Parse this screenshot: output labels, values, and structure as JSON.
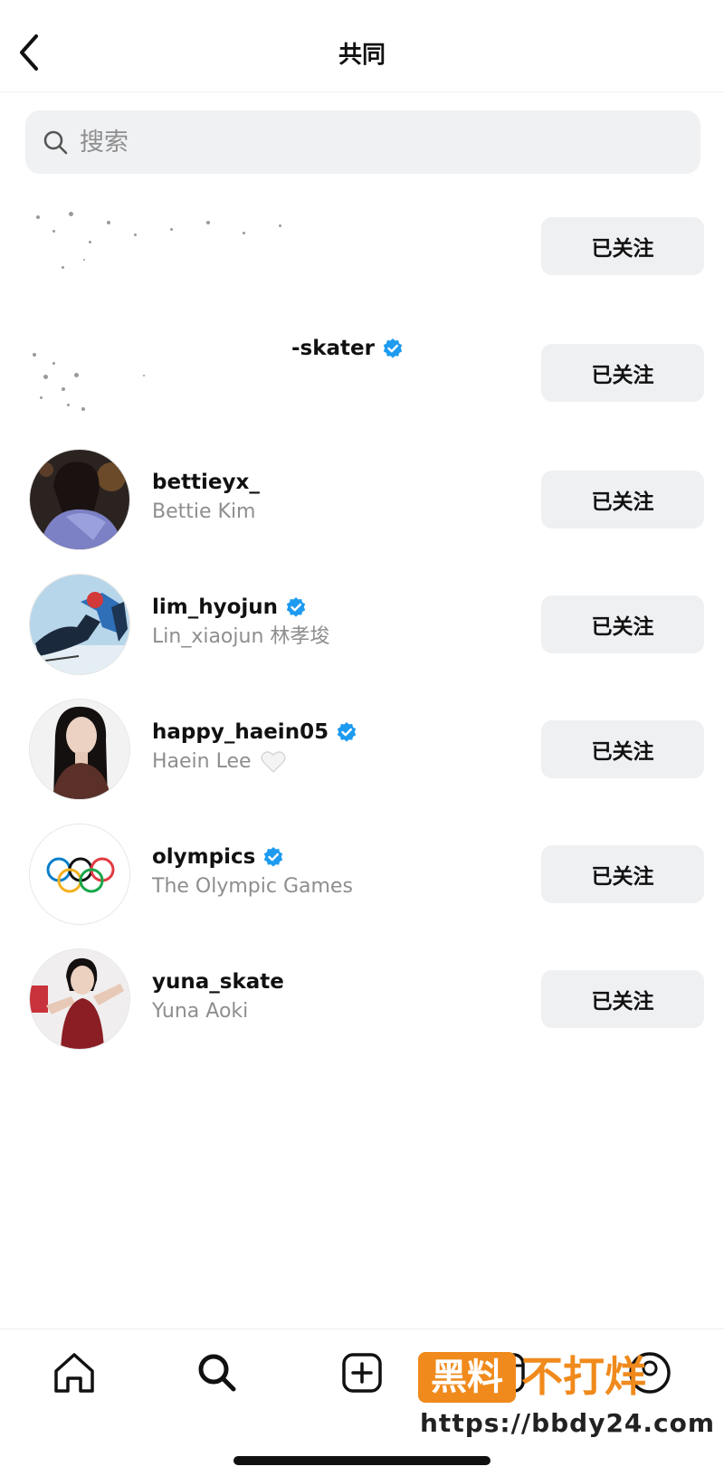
{
  "header": {
    "title": "共同"
  },
  "search": {
    "placeholder": "搜索"
  },
  "users": [
    {
      "username": "",
      "fullname": "",
      "follow_label": "已关注",
      "verified": false,
      "redacted": true
    },
    {
      "username": "-skater",
      "fullname": "",
      "follow_label": "已关注",
      "verified": true,
      "redacted": true
    },
    {
      "username": "bettieyx_",
      "fullname": "Bettie Kim",
      "follow_label": "已关注",
      "verified": false
    },
    {
      "username": "lim_hyojun",
      "fullname": "Lin_xiaojun 林孝埈",
      "follow_label": "已关注",
      "verified": true
    },
    {
      "username": "happy_haein05",
      "fullname": "Haein Lee",
      "follow_label": "已关注",
      "verified": true,
      "fullname_suffix_icon": "white-heart-icon"
    },
    {
      "username": "olympics",
      "fullname": "The Olympic Games",
      "follow_label": "已关注",
      "verified": true
    },
    {
      "username": "yuna_skate",
      "fullname": "Yuna Aoki",
      "follow_label": "已关注",
      "verified": false
    }
  ],
  "bottom_nav": [
    "home-icon",
    "search-icon",
    "create-icon",
    "reels-icon",
    "profile-icon"
  ],
  "watermark": {
    "badge": "黑料",
    "text": "不打烊",
    "url": "https://bbdy24.com"
  },
  "colors": {
    "verified": "#1d9bf0",
    "button_bg": "#eff0f2",
    "secondary_text": "#8e8e8e",
    "watermark": "#f08a1c"
  }
}
